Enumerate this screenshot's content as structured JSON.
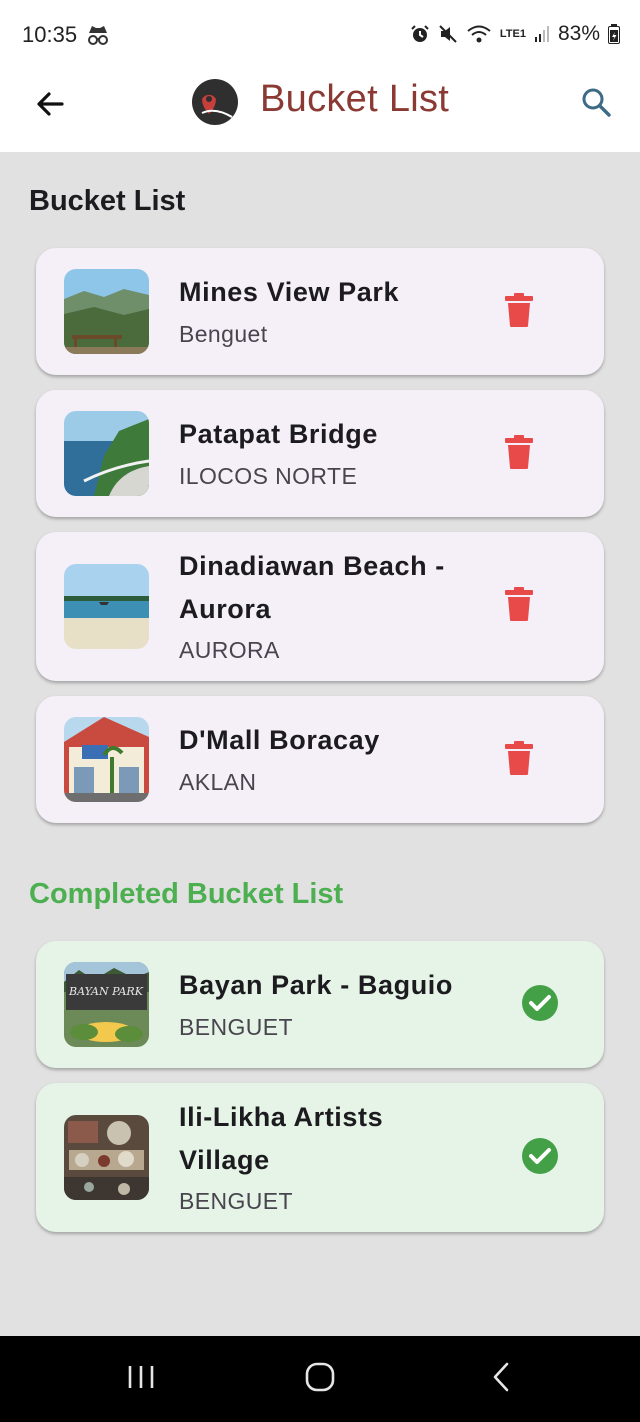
{
  "status": {
    "time": "10:35",
    "battery": "83%",
    "network": "LTE1"
  },
  "header": {
    "title": "Bucket List",
    "title_color": "#8a3a33"
  },
  "bucket": {
    "title": "Bucket List",
    "items": [
      {
        "name": "Mines View Park",
        "province": "Benguet",
        "thumb": "mountain-view"
      },
      {
        "name": "Patapat Bridge",
        "province": "ILOCOS NORTE",
        "thumb": "coastal-bridge"
      },
      {
        "name": "Dinadiawan Beach - Aurora",
        "province": "AURORA",
        "thumb": "beach"
      },
      {
        "name": "D'Mall Boracay",
        "province": "AKLAN",
        "thumb": "mall"
      }
    ]
  },
  "completed": {
    "title": "Completed Bucket List",
    "title_color": "#4caf50",
    "items": [
      {
        "name": "Bayan Park - Baguio",
        "province": "BENGUET",
        "thumb": "park-sign",
        "sign_text": "BAYAN PARK"
      },
      {
        "name": "Ili-Likha Artists Village",
        "province": "BENGUET",
        "thumb": "artists-village"
      }
    ]
  },
  "colors": {
    "delete": "#e84a4a",
    "check": "#43a047",
    "pending_card": "#f5f0f8",
    "done_card": "#e5f4e6"
  }
}
